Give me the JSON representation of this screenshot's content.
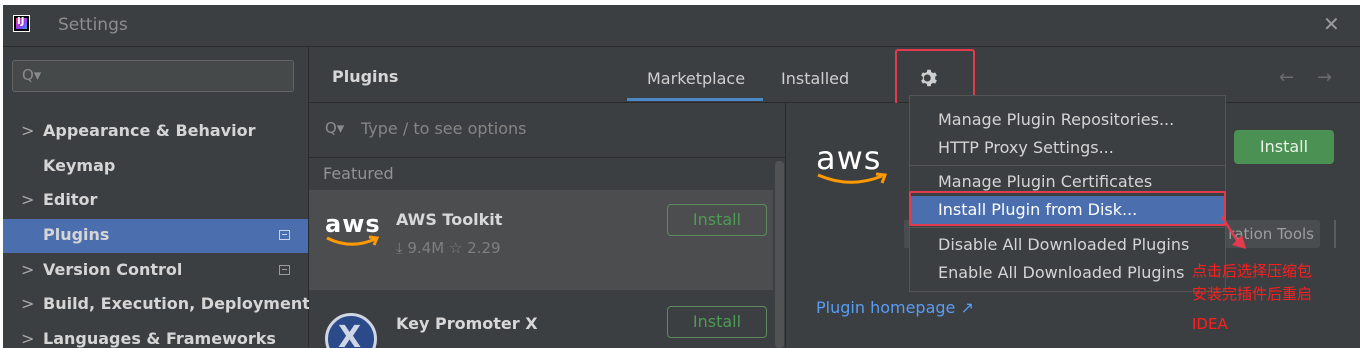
{
  "window": {
    "title": "Settings",
    "close_glyph": "✕",
    "app_logo_text": "IJ",
    "colors": {
      "bg": "#3c3f41",
      "accent": "#4b6eaf",
      "annotation": "#e33a4d",
      "install_green": "#4b9154",
      "link": "#589df6"
    }
  },
  "sidebar": {
    "search_icon": "search-icon",
    "items": [
      {
        "label": "Appearance & Behavior",
        "chevron": ">",
        "badge": false,
        "active": false
      },
      {
        "label": "Keymap",
        "chevron": "",
        "badge": false,
        "active": false
      },
      {
        "label": "Editor",
        "chevron": ">",
        "badge": false,
        "active": false
      },
      {
        "label": "Plugins",
        "chevron": "",
        "badge": true,
        "active": true
      },
      {
        "label": "Version Control",
        "chevron": ">",
        "badge": true,
        "active": false
      },
      {
        "label": "Build, Execution, Deployment",
        "chevron": ">",
        "badge": false,
        "active": false
      },
      {
        "label": "Languages & Frameworks",
        "chevron": ">",
        "badge": false,
        "active": false
      }
    ]
  },
  "header": {
    "title": "Plugins",
    "tabs": [
      {
        "label": "Marketplace",
        "selected": true
      },
      {
        "label": "Installed",
        "selected": false
      }
    ],
    "gear_icon": "gear-icon",
    "back_glyph": "←",
    "forward_glyph": "→"
  },
  "plugin_list": {
    "search_placeholder": "Type / to see options",
    "section_label": "Featured",
    "plugins": [
      {
        "name": "AWS Toolkit",
        "stats": "⤓ 9.4M  ☆ 2.29",
        "install_label": "Install",
        "logo": "aws"
      },
      {
        "name": "Key Promoter X",
        "stats": "",
        "install_label": "Install",
        "logo": "X"
      }
    ]
  },
  "detail": {
    "logo_text": "aws",
    "install_label": "Install",
    "tag_fragment": "ration Tools",
    "homepage_link": "Plugin homepage ↗"
  },
  "menu": {
    "items": [
      {
        "label": "Manage Plugin Repositories...",
        "selected": false
      },
      {
        "label": "HTTP Proxy Settings...",
        "selected": false
      },
      {
        "label": "Manage Plugin Certificates",
        "selected": false
      },
      {
        "label": "Install Plugin from Disk...",
        "selected": true
      },
      {
        "label": "Disable All Downloaded Plugins",
        "selected": false
      },
      {
        "label": "Enable All Downloaded Plugins",
        "selected": false
      }
    ]
  },
  "annotation": {
    "lines": [
      "点击后选择压缩包",
      "安装完插件后重启",
      "IDEA"
    ]
  }
}
